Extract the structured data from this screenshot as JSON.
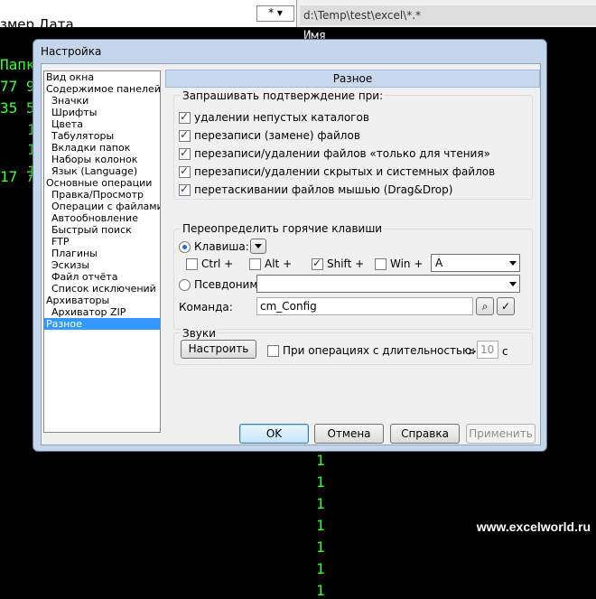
{
  "background": {
    "left_header": "змер   Дата",
    "star_filter": "*",
    "right_path": "d:\\Temp\\test\\excel\\*.*",
    "right_header": "Имя",
    "left_green": [
      "Папк",
      "77 9",
      "35 5",
      "1",
      "1",
      "1",
      "17 7"
    ],
    "right_green": [
      "1",
      "1",
      "1",
      "1",
      "1",
      "1",
      "1"
    ],
    "watermark": "www.excelworld.ru"
  },
  "dialog": {
    "title": "Настройка",
    "tree": [
      {
        "label": "Вид окна",
        "level": 1
      },
      {
        "label": "Содержимое панелей",
        "level": 1
      },
      {
        "label": "Значки",
        "level": 2
      },
      {
        "label": "Шрифты",
        "level": 2
      },
      {
        "label": "Цвета",
        "level": 2
      },
      {
        "label": "Табуляторы",
        "level": 2
      },
      {
        "label": "Вкладки папок",
        "level": 2
      },
      {
        "label": "Наборы колонок",
        "level": 2
      },
      {
        "label": "Язык (Language)",
        "level": 2
      },
      {
        "label": "Основные операции",
        "level": 1
      },
      {
        "label": "Правка/Просмотр",
        "level": 2
      },
      {
        "label": "Операции с файлами",
        "level": 2
      },
      {
        "label": "Автообновление",
        "level": 2
      },
      {
        "label": "Быстрый поиск",
        "level": 2
      },
      {
        "label": "FTP",
        "level": 2
      },
      {
        "label": "Плагины",
        "level": 2
      },
      {
        "label": "Эскизы",
        "level": 2
      },
      {
        "label": "Файл отчёта",
        "level": 2
      },
      {
        "label": "Список исключений",
        "level": 2
      },
      {
        "label": "Архиваторы",
        "level": 1
      },
      {
        "label": "Архиватор ZIP",
        "level": 2
      },
      {
        "label": "Разное",
        "level": 1,
        "selected": true
      }
    ],
    "panel_title": "Разное",
    "confirm": {
      "title": "Запрашивать подтверждение при:",
      "items": [
        "удалении непустых каталогов",
        "перезаписи (замене) файлов",
        "перезаписи/удалении файлов «только для чтения»",
        "перезаписи/удалении скрытых и системных файлов",
        "перетаскивании файлов мышью (Drag&Drop)"
      ]
    },
    "hotkeys": {
      "title": "Переопределить горячие клавиши",
      "key_label": "Клавиша:",
      "ctrl": "Ctrl +",
      "alt": "Alt +",
      "shift": "Shift +",
      "win": "Win +",
      "key_value": "A",
      "alias_label": "Псевдоним:",
      "alias_value": "",
      "command_label": "Команда:",
      "command_value": "cm_Config"
    },
    "sounds": {
      "title": "Звуки",
      "configure": "Настроить",
      "duration_label": "При операциях с длительностью:",
      "gt": ">",
      "seconds": "10",
      "unit": "с"
    },
    "buttons": {
      "ok": "OK",
      "cancel": "Отмена",
      "help": "Справка",
      "apply": "Применить"
    }
  }
}
